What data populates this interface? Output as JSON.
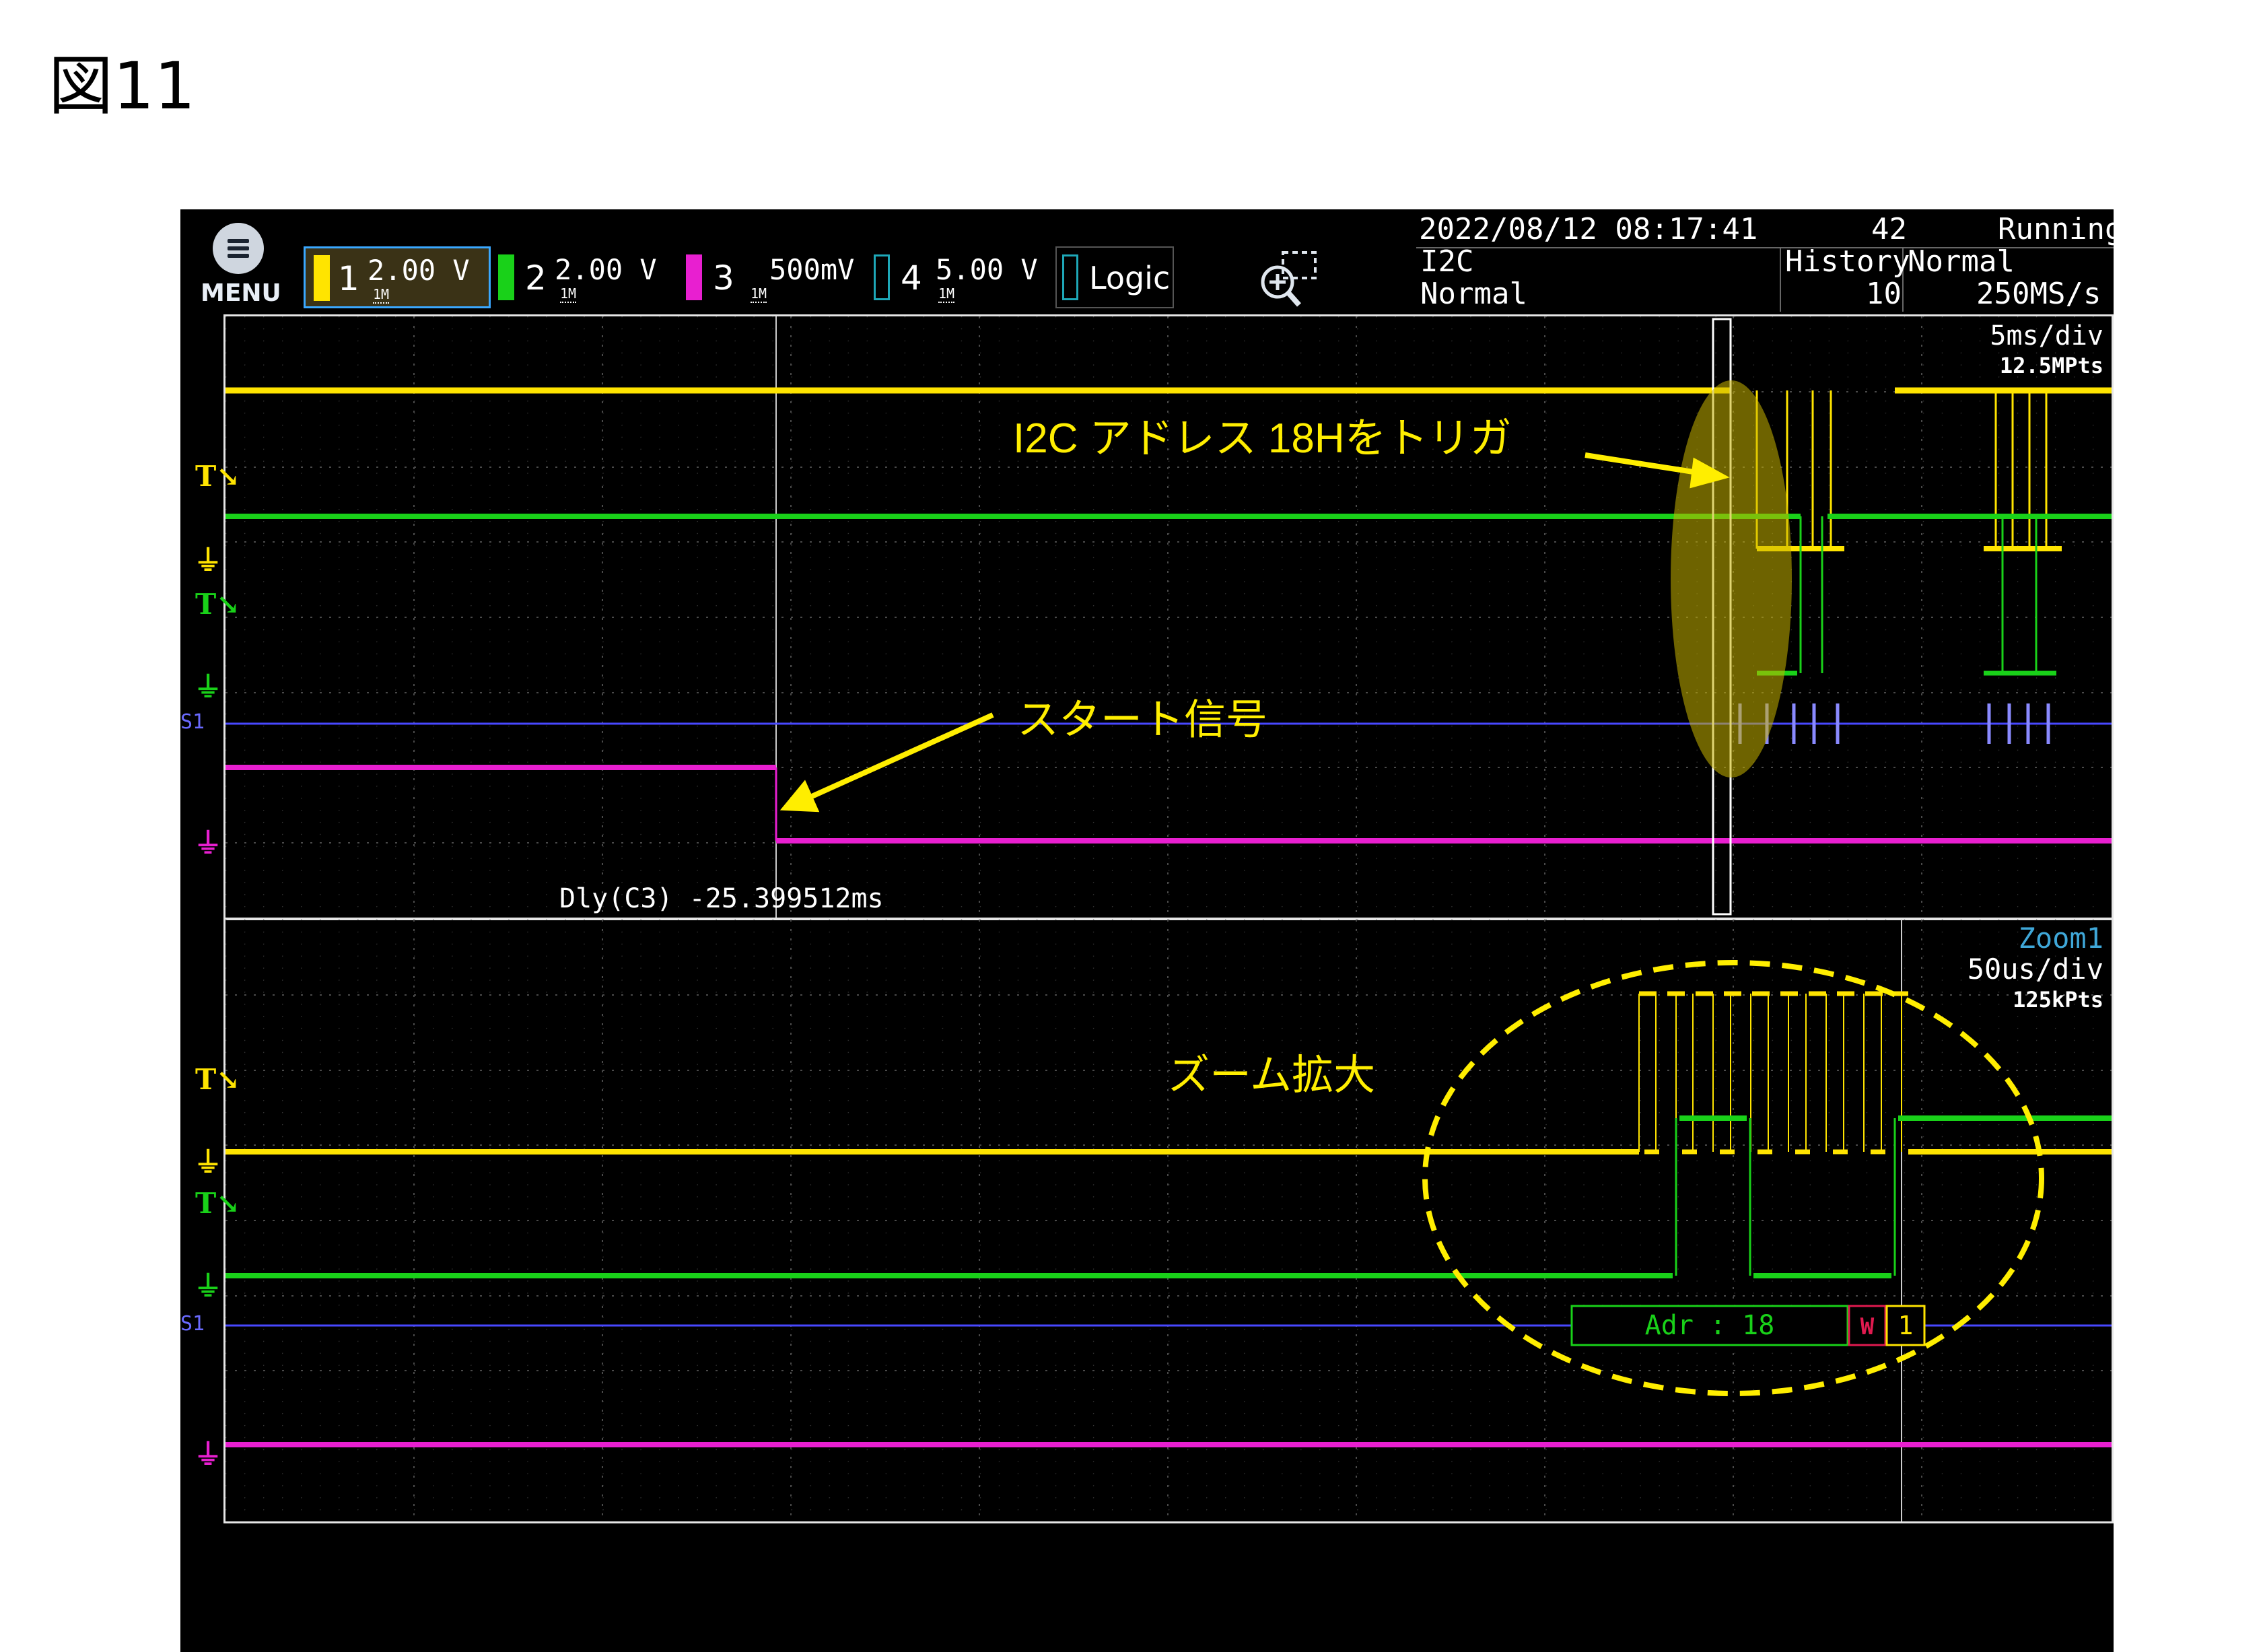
{
  "figure": {
    "title": "図11"
  },
  "header": {
    "menu_label": "MENU",
    "channels": [
      {
        "num": "1",
        "scale": "2.00 V",
        "imp": "1M",
        "color": "#ffe400",
        "selected": true
      },
      {
        "num": "2",
        "scale": "2.00 V",
        "imp": "1M",
        "color": "#19d119",
        "selected": false
      },
      {
        "num": "3",
        "scale": "500mV",
        "imp": "1M",
        "color": "#e81fd0",
        "selected": false
      },
      {
        "num": "4",
        "scale": "5.00 V",
        "imp": "1M",
        "color": "#1ea8b8",
        "selected": false
      }
    ],
    "logic_label": "Logic",
    "datetime": "2022/08/12 08:17:41",
    "count": "42",
    "run_state": "Running",
    "trigger_type": "I2C",
    "trigger_mode": "Normal",
    "history_label": "History",
    "history_value": "10",
    "acq_mode": "Normal",
    "sample_rate": "250MS/s"
  },
  "main_view": {
    "timebase": "5ms/div",
    "points": "12.5MPts",
    "delay_readout": "Dly(C3) -25.399512ms",
    "serial_label": "S1"
  },
  "zoom_view": {
    "name": "Zoom1",
    "timebase": "50us/div",
    "points": "125kPts",
    "decode_address": "Adr : 18",
    "decode_rw": "W",
    "decode_ack": "1",
    "serial_label": "S1"
  },
  "annotations": {
    "trigger_note": "I2C  アドレス  18Hをトリガ",
    "start_note": "スタート信号",
    "zoom_note": "ズーム拡大",
    "highlight_color": "#ffee00"
  }
}
